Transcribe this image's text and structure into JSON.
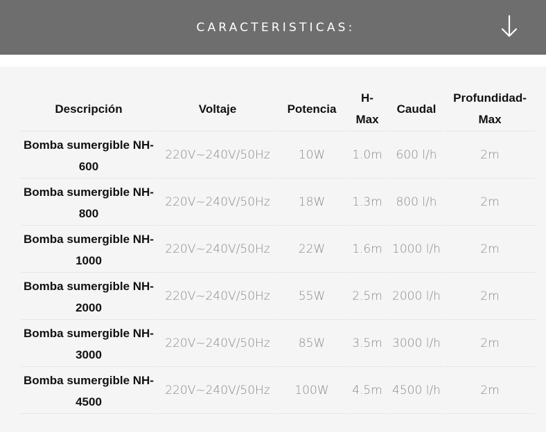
{
  "header": {
    "title": "CARACTERISTICAS:",
    "arrow_icon": "arrow-down-icon"
  },
  "colors": {
    "header_bg": "#6e6e6e",
    "panel_bg": "#f5f5f5",
    "value_text": "#8a8a8a",
    "label_text": "#111111"
  },
  "table": {
    "columns": [
      "Descripción",
      "Voltaje",
      "Potencia",
      "H-\nMax",
      "Caudal",
      "Profundidad-\nMax"
    ],
    "rows": [
      {
        "desc": "Bomba sumergible NH-600",
        "voltaje": "220V~240V/50Hz",
        "potencia": "10W",
        "hmax": "1.0m",
        "caudal": "600 l/h",
        "prof": "2m"
      },
      {
        "desc": "Bomba sumergible NH-800",
        "voltaje": "220V~240V/50Hz",
        "potencia": "18W",
        "hmax": "1.3m",
        "caudal": "800 l/h",
        "prof": "2m"
      },
      {
        "desc": "Bomba sumergible NH-1000",
        "voltaje": "220V~240V/50Hz",
        "potencia": "22W",
        "hmax": "1.6m",
        "caudal": "1000 l/h",
        "prof": "2m"
      },
      {
        "desc": "Bomba sumergible NH-2000",
        "voltaje": "220V~240V/50Hz",
        "potencia": "55W",
        "hmax": "2.5m",
        "caudal": "2000 l/h",
        "prof": "2m"
      },
      {
        "desc": "Bomba sumergible NH-3000",
        "voltaje": "220V~240V/50Hz",
        "potencia": "85W",
        "hmax": "3.5m",
        "caudal": "3000 l/h",
        "prof": "2m"
      },
      {
        "desc": "Bomba sumergible NH-4500",
        "voltaje": "220V~240V/50Hz",
        "potencia": "100W",
        "hmax": "4.5m",
        "caudal": "4500 l/h",
        "prof": "2m"
      }
    ]
  }
}
